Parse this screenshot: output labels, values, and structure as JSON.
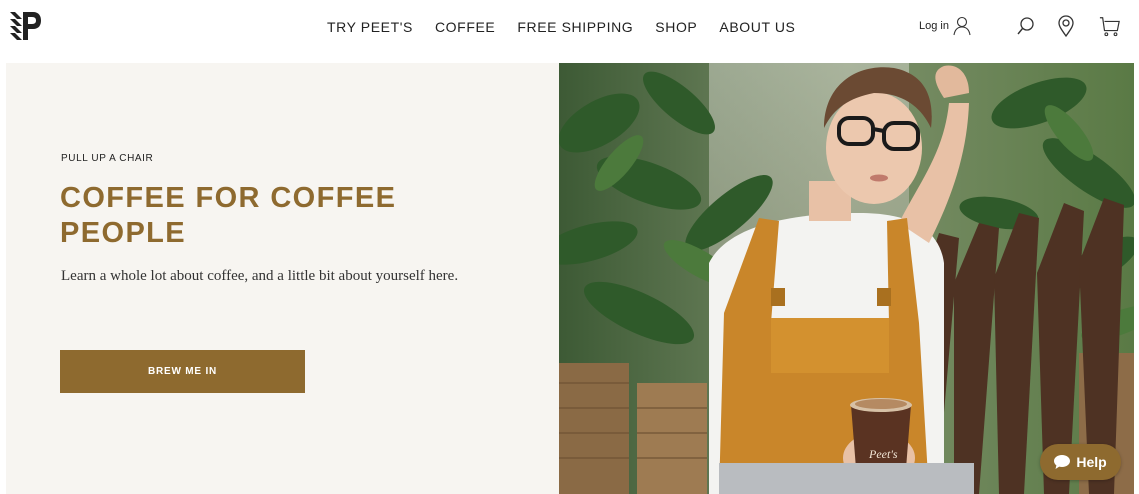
{
  "header": {
    "nav": [
      "TRY PEET'S",
      "COFFEE",
      "FREE SHIPPING",
      "SHOP",
      "ABOUT US"
    ],
    "login_label": "Log in"
  },
  "hero": {
    "eyebrow": "PULL UP A CHAIR",
    "headline": "COFFEE FOR COFFEE PEOPLE",
    "lead": "Learn a whole lot about coffee, and a little bit about yourself here.",
    "cta_label": "BREW ME IN",
    "cup_brand": "Peet's"
  },
  "help": {
    "label": "Help"
  },
  "colors": {
    "accent": "#8e6a2f",
    "panel_background": "#f7f5f1",
    "text": "#222222"
  },
  "icons": [
    "peets-logo-icon",
    "user-icon",
    "search-icon",
    "location-pin-icon",
    "cart-icon",
    "chat-bubble-icon"
  ]
}
